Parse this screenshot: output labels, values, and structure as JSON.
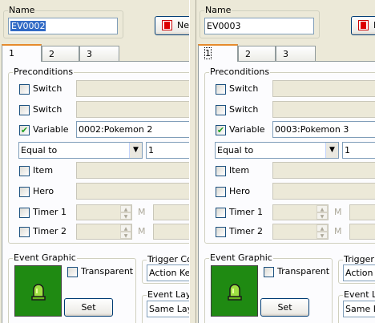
{
  "left": {
    "name_label": "Name",
    "name_value": "EV0002",
    "new_button_label": "New",
    "tabs": [
      {
        "label": "1"
      },
      {
        "label": "2"
      },
      {
        "label": "3"
      }
    ],
    "preconditions": {
      "title": "Preconditions",
      "switch1_label": "Switch",
      "switch2_label": "Switch",
      "variable_label": "Variable",
      "variable_value": "0002:Pokemon 2",
      "operator": "Equal to",
      "amount": "1",
      "item_label": "Item",
      "hero_label": "Hero",
      "timer1_label": "Timer 1",
      "timer2_label": "Timer 2",
      "m1": "M",
      "m2": "M"
    },
    "event_graphic": {
      "title": "Event Graphic",
      "transparent_label": "Transparent",
      "set_label": "Set"
    },
    "trigger": {
      "title": "Trigger Co",
      "value": "Action Ke"
    },
    "layer": {
      "title": "Event Layer",
      "value": "Same Lay"
    }
  },
  "right": {
    "name_label": "Name",
    "name_value": "EV0003",
    "new_button_label": "N",
    "tabs": [
      {
        "label": "1"
      },
      {
        "label": "2"
      },
      {
        "label": "3"
      }
    ],
    "preconditions": {
      "title": "Preconditions",
      "switch1_label": "Switch",
      "switch2_label": "Switch",
      "variable_label": "Variable",
      "variable_value": "0003:Pokemon 3",
      "operator": "Equal to",
      "amount": "1",
      "item_label": "Item",
      "hero_label": "Hero",
      "timer1_label": "Timer 1",
      "timer2_label": "Timer 2",
      "m1": "M",
      "m2": "M"
    },
    "event_graphic": {
      "title": "Event Graphic",
      "transparent_label": "Transparent",
      "set_label": "Set"
    },
    "trigger": {
      "title": "Trigger C",
      "value": "Action"
    },
    "layer": {
      "title": "Event La",
      "value": "Same La"
    }
  },
  "icons": {
    "new_icon": "red-p-icon",
    "graphic": "green-bell-sprite"
  },
  "colors": {
    "selection": "#316ac5",
    "graphic_bg": "#1f8a12",
    "window": "#ece9d8"
  }
}
